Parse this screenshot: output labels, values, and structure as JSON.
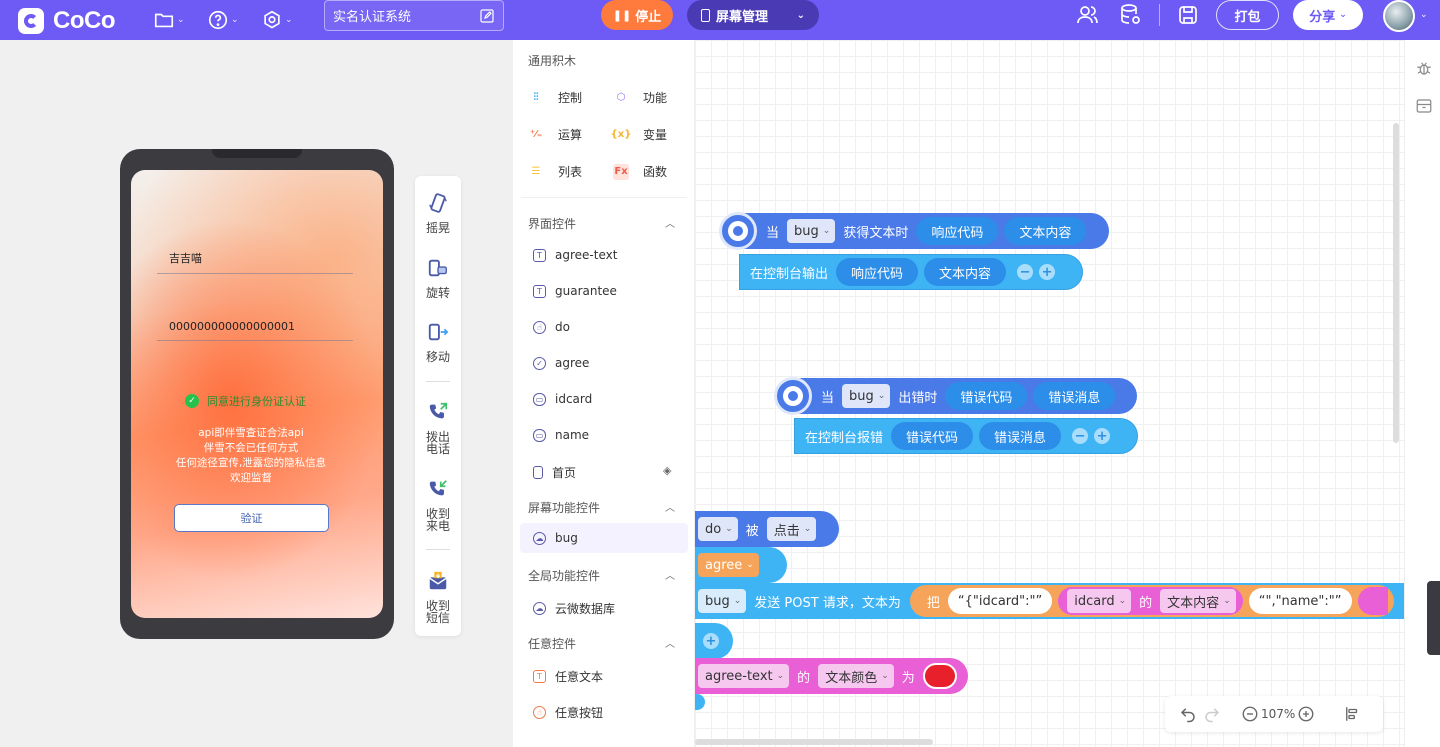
{
  "app": {
    "name": "CoCo"
  },
  "header": {
    "project_title": "实名认证系统",
    "stop_label": "停止",
    "screen_manage_label": "屏幕管理",
    "pack_label": "打包",
    "share_label": "分享"
  },
  "simulator": {
    "fields": [
      "吉吉喵",
      "000000000000000001"
    ],
    "agree_text": "同意进行身份证认证",
    "notice_lines": [
      "api即伴雪查证合法api",
      "伴雪不会已任何方式",
      "任何途径宣传,泄露您的隐私信息",
      "欢迎监督"
    ],
    "verify_button": "验证",
    "tools": [
      {
        "label": "摇晃",
        "icon": "shake-icon"
      },
      {
        "label": "旋转",
        "icon": "rotate-icon"
      },
      {
        "label": "移动",
        "icon": "move-icon"
      },
      {
        "label": "拨出电话",
        "icon": "call-out-icon"
      },
      {
        "label": "收到来电",
        "icon": "call-in-icon"
      },
      {
        "label": "收到短信",
        "icon": "sms-icon"
      }
    ]
  },
  "palette": {
    "common_title": "通用积木",
    "categories": [
      {
        "label": "控制",
        "color": "#2ea8f5"
      },
      {
        "label": "功能",
        "color": "#9a6cf0"
      },
      {
        "label": "运算",
        "color": "#f07a4a"
      },
      {
        "label": "变量",
        "color": "#f5b52a"
      },
      {
        "label": "列表",
        "color": "#f5c43a"
      },
      {
        "label": "函数",
        "color": "#f05a4a"
      }
    ],
    "ui_section": "界面控件",
    "ui_widgets": [
      "agree-text",
      "guarantee",
      "do",
      "agree",
      "idcard",
      "name",
      "首页"
    ],
    "screen_section": "屏幕功能控件",
    "screen_widgets": [
      "bug"
    ],
    "global_section": "全局功能控件",
    "global_widgets": [
      "云微数据库"
    ],
    "any_section": "任意控件",
    "any_widgets": [
      "任意文本",
      "任意按钮"
    ]
  },
  "workspace": {
    "block1": {
      "when": "当",
      "obj": "bug",
      "event": "获得文本时",
      "p1": "响应代码",
      "p2": "文本内容",
      "inner": "在控制台输出",
      "i1": "响应代码",
      "i2": "文本内容"
    },
    "block2": {
      "when": "当",
      "obj": "bug",
      "event": "出错时",
      "p1": "错误代码",
      "p2": "错误消息",
      "inner": "在控制台报错",
      "i1": "错误代码",
      "i2": "错误消息"
    },
    "block3": {
      "obj": "do",
      "by": "被",
      "action": "点击",
      "cond": "agree",
      "req_obj": "bug",
      "req_text": "发送 POST 请求，文本为",
      "put": "把",
      "s1": "“{\"idcard\":\"”",
      "w1": "idcard",
      "of": "的",
      "prop": "文本内容",
      "s2": "“\",\"name\":\"”",
      "set_obj": "agree-text",
      "set_of": "的",
      "set_prop": "文本颜色",
      "set_to": "为"
    },
    "zoom": "107%",
    "colors": {
      "hat": "#4a79e8",
      "cyan": "#3fb4f5",
      "pill": "#2c8ee8",
      "pink": "#e85fd6",
      "orange": "#f5a45a",
      "red": "#e8202c"
    }
  }
}
